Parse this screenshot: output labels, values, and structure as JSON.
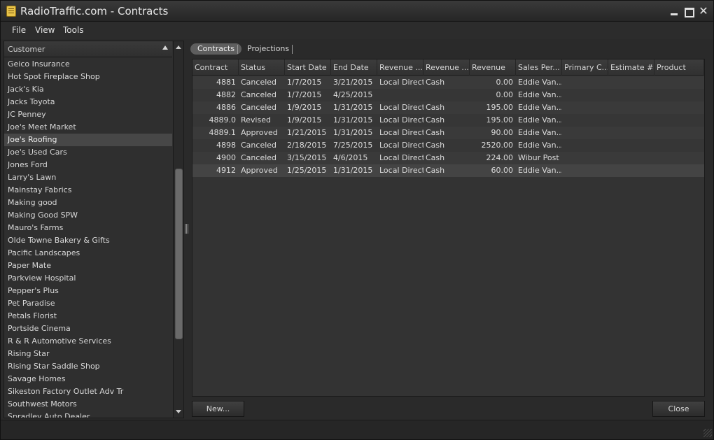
{
  "window": {
    "title": "RadioTraffic.com - Contracts",
    "close_glyph": "✕"
  },
  "menu": [
    "File",
    "View",
    "Tools"
  ],
  "customer_list": {
    "header": "Customer",
    "items": [
      "Geico Insurance",
      "Hot Spot Fireplace Shop",
      "Jack's Kia",
      "Jacks Toyota",
      "JC Penney",
      "Joe's Meet Market",
      "Joe's Roofing",
      "Joe's Used Cars",
      "Jones Ford",
      "Larry's Lawn",
      "Mainstay Fabrics",
      "Making good",
      "Making Good SPW",
      "Mauro's Farms",
      "Olde Towne Bakery & Gifts",
      "Pacific Landscapes",
      "Paper Mate",
      "Parkview Hospital",
      "Pepper's Plus",
      "Pet Paradise",
      "Petals Florist",
      "Portside Cinema",
      "R & R Automotive Services",
      "Rising Star",
      "Rising Star Saddle Shop",
      "Savage Homes",
      "Sikeston Factory Outlet Adv Tr",
      "Southwest Motors",
      "Spradley Auto Dealer"
    ],
    "selected_index": 6
  },
  "tabs": {
    "contracts": "Contracts",
    "projections": "Projections",
    "active": "Contracts"
  },
  "grid": {
    "columns": [
      "Contract",
      "Status",
      "Start Date",
      "End Date",
      "Revenue ...",
      "Revenue ...",
      "Revenue",
      "Sales Per...",
      "Primary C...",
      "Estimate #",
      "Product"
    ],
    "rows": [
      [
        "4881",
        "Canceled",
        "1/7/2015",
        "3/21/2015",
        "Local Direct",
        "Cash",
        "0.00",
        "Eddie Van...",
        "",
        "",
        ""
      ],
      [
        "4882",
        "Canceled",
        "1/7/2015",
        "4/25/2015",
        "",
        "",
        "0.00",
        "Eddie Van...",
        "",
        "",
        ""
      ],
      [
        "4886",
        "Canceled",
        "1/9/2015",
        "1/31/2015",
        "Local Direct",
        "Cash",
        "195.00",
        "Eddie Van...",
        "",
        "",
        ""
      ],
      [
        "4889.0",
        "Revised",
        "1/9/2015",
        "1/31/2015",
        "Local Direct",
        "Cash",
        "195.00",
        "Eddie Van...",
        "",
        "",
        ""
      ],
      [
        "4889.1",
        "Approved",
        "1/21/2015",
        "1/31/2015",
        "Local Direct",
        "Cash",
        "90.00",
        "Eddie Van...",
        "",
        "",
        ""
      ],
      [
        "4898",
        "Canceled",
        "2/18/2015",
        "7/25/2015",
        "Local Direct",
        "Cash",
        "2520.00",
        "Eddie Van...",
        "",
        "",
        ""
      ],
      [
        "4900",
        "Canceled",
        "3/15/2015",
        "4/6/2015",
        "Local Direct",
        "Cash",
        "224.00",
        "Wibur  Post",
        "",
        "",
        ""
      ],
      [
        "4912",
        "Approved",
        "1/25/2015",
        "1/31/2015",
        "Local Direct",
        "Cash",
        "60.00",
        "Eddie Van...",
        "",
        "",
        ""
      ]
    ],
    "selected_index": 7
  },
  "buttons": {
    "new": "New...",
    "close": "Close"
  }
}
